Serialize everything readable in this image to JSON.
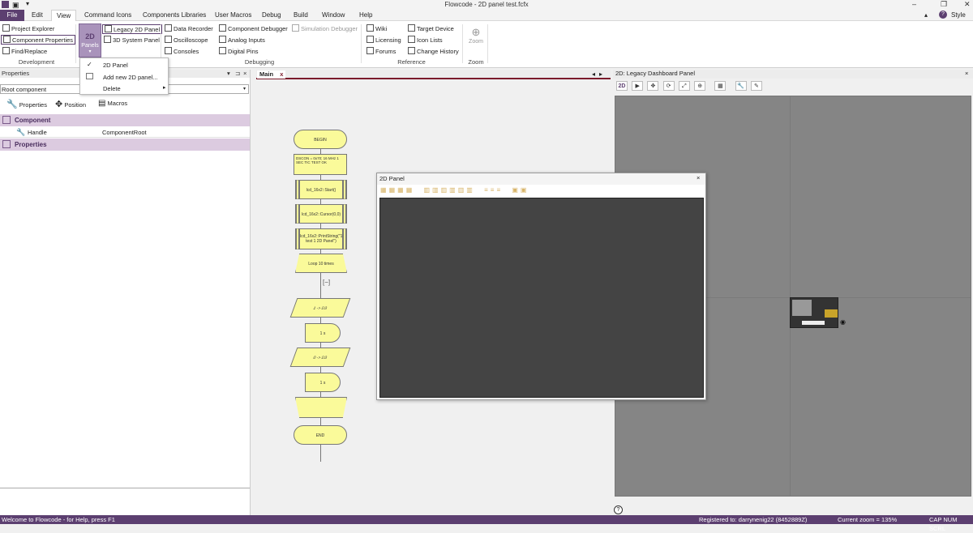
{
  "window": {
    "title": "Flowcode - 2D panel test.fcfx",
    "style_label": "Style",
    "help_glyph": "?"
  },
  "menu": {
    "tabs": [
      "File",
      "Edit",
      "View",
      "Command Icons",
      "Components Libraries",
      "User Macros",
      "Debug",
      "Build",
      "Window",
      "Help"
    ],
    "active": "View"
  },
  "ribbon": {
    "development": {
      "label": "Development",
      "items": [
        "Project Explorer",
        "Component Properties",
        "Find/Replace"
      ]
    },
    "panels": {
      "button_label": "2D",
      "button_sub": "Panels",
      "items": [
        "Legacy 2D Panel",
        "3D System Panel"
      ]
    },
    "debugging": {
      "label": "Debugging",
      "col1": [
        "Data Recorder",
        "Oscilloscope",
        "Consoles"
      ],
      "col2": [
        "Component Debugger",
        "Analog Inputs",
        "Digital Pins"
      ],
      "col3": [
        "Simulation Debugger"
      ]
    },
    "reference": {
      "label": "Reference",
      "col1": [
        "Wiki",
        "Licensing",
        "Forums"
      ],
      "col2": [
        "Target Device",
        "Icon Lists",
        "Change History"
      ]
    },
    "zoom": {
      "label": "Zoom",
      "button": "Zoom"
    }
  },
  "dropdown": {
    "items": [
      "2D Panel",
      "Add new 2D panel...",
      "Delete"
    ]
  },
  "properties": {
    "title": "Properties",
    "selector": "Root component",
    "tabs": [
      "Properties",
      "Position",
      "Macros"
    ],
    "section_component": "Component",
    "row_handle_label": "Handle",
    "row_handle_value": "ComponentRoot",
    "section_properties": "Properties"
  },
  "main_tab": {
    "label": "Main",
    "close": "x"
  },
  "flowchart": {
    "begin": "BEGIN",
    "calc": "DSCON = 0x70; 16 MHz 1 SEC TIC TEST OK",
    "m1": "lcd_16x2::Start()",
    "m2": "lcd_16x2::Cursor(0,0)",
    "m3": "lcd_16x2::PrintString(\"1 test 1 2D Panel\")",
    "loop": "Loop 10 times",
    "collapse": "[−]",
    "out1": "1 -> D3",
    "d1": "1 s",
    "out2": "0 -> D3",
    "d2": "1 s",
    "end": "END"
  },
  "popup": {
    "title": "2D Panel",
    "close": "×"
  },
  "right_panel": {
    "title": "2D: Legacy Dashboard Panel"
  },
  "status": {
    "left": "Welcome to Flowcode - for Help, press F1",
    "registered": "Registered to: darrynenig22 (8452889Z)",
    "zoom": "Current zoom = 135%",
    "keys": "CAP  NUM  SCRL"
  },
  "colors": {
    "accent": "#5c3f70",
    "section": "#dccbe0",
    "flow": "#fafa9a",
    "panel_bg": "#444444",
    "dashboard_bg": "#858585"
  }
}
